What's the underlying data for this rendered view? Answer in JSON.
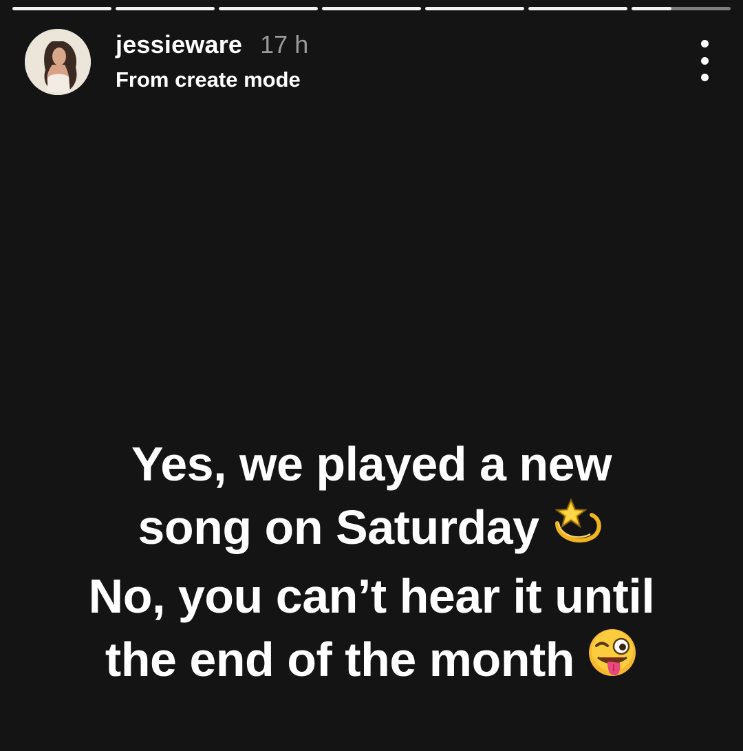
{
  "story": {
    "progress_segments": [
      1,
      1,
      1,
      1,
      1,
      1,
      0.4
    ],
    "username": "jessieware",
    "time_ago": "17 h",
    "subtitle": "From create mode",
    "avatar_icon": "profile-photo",
    "more_icon": "vertical-ellipsis-icon"
  },
  "caption": {
    "line1": "Yes, we played a new",
    "line2": "song on Saturday",
    "line2_emoji": "dizzy-star-emoji",
    "line3": "No, you can’t hear it until",
    "line4": "the end of the month",
    "line4_emoji": "winking-face-with-tongue-emoji"
  },
  "colors": {
    "background": "#141414",
    "text": "#ffffff",
    "muted": "#9a9a9a"
  }
}
